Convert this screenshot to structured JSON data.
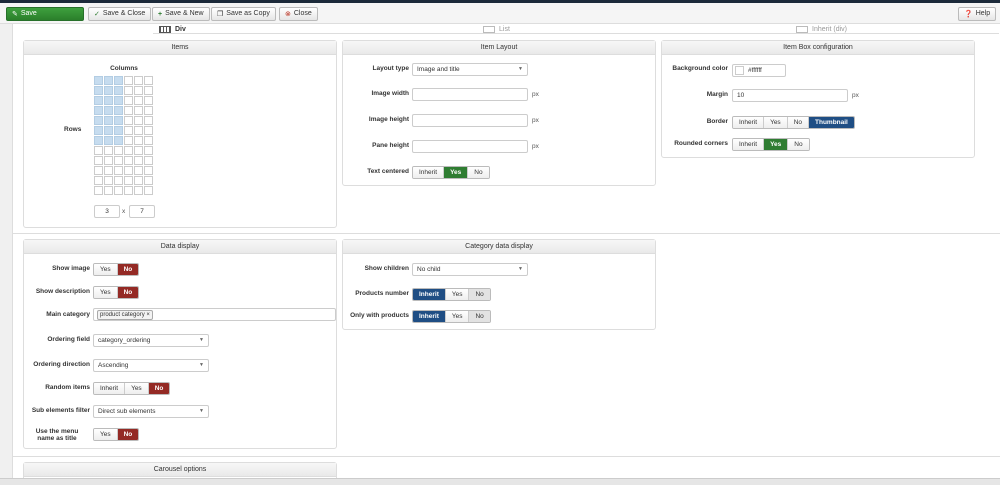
{
  "toolbar": {
    "save": "Save",
    "save_close": "Save & Close",
    "save_new": "Save & New",
    "save_copy": "Save as Copy",
    "close": "Close",
    "help": "Help"
  },
  "tabs": {
    "div": "Div",
    "list": "List",
    "inherit": "Inherit (div)"
  },
  "items_panel": {
    "title": "Items",
    "columns_label": "Columns",
    "rows_label": "Rows",
    "columns_value": "3",
    "separator": "x",
    "rows_value": "7"
  },
  "layout_panel": {
    "title": "Item Layout",
    "layout_type_label": "Layout type",
    "layout_type_value": "Image and title",
    "image_width_label": "Image width",
    "image_height_label": "Image height",
    "pane_height_label": "Pane height",
    "unit": "px",
    "text_centered_label": "Text centered",
    "options": [
      "Inherit",
      "Yes",
      "No"
    ]
  },
  "box_panel": {
    "title": "Item Box configuration",
    "bg_color_label": "Background color",
    "bg_color_value": "#ffffff",
    "margin_label": "Margin",
    "margin_value": "10",
    "unit": "px",
    "border_label": "Border",
    "border_options": [
      "Inherit",
      "Yes",
      "No",
      "Thumbnail"
    ],
    "rounded_label": "Rounded corners",
    "rounded_options": [
      "Inherit",
      "Yes",
      "No"
    ]
  },
  "data_panel": {
    "title": "Data display",
    "show_image_label": "Show image",
    "show_desc_label": "Show description",
    "main_category_label": "Main category",
    "main_category_tag": "product category",
    "ordering_field_label": "Ordering field",
    "ordering_field_value": "category_ordering",
    "ordering_direction_label": "Ordering direction",
    "ordering_direction_value": "Ascending",
    "random_items_label": "Random items",
    "sub_filter_label": "Sub elements filter",
    "sub_filter_value": "Direct sub elements",
    "menu_name_label_1": "Use the menu",
    "menu_name_label_2": "name as title",
    "yes": "Yes",
    "no": "No",
    "inherit": "Inherit"
  },
  "category_panel": {
    "title": "Category data display",
    "show_children_label": "Show children",
    "show_children_value": "No child",
    "products_number_label": "Products number",
    "only_products_label": "Only with products",
    "options": [
      "Inherit",
      "Yes",
      "No"
    ]
  },
  "carousel_panel": {
    "title": "Carousel options"
  },
  "colors": {
    "save_green": "#2f7d32",
    "no_red": "#942a25",
    "active_blue": "#1f4e84",
    "grid_selected": "#c6dcef"
  }
}
